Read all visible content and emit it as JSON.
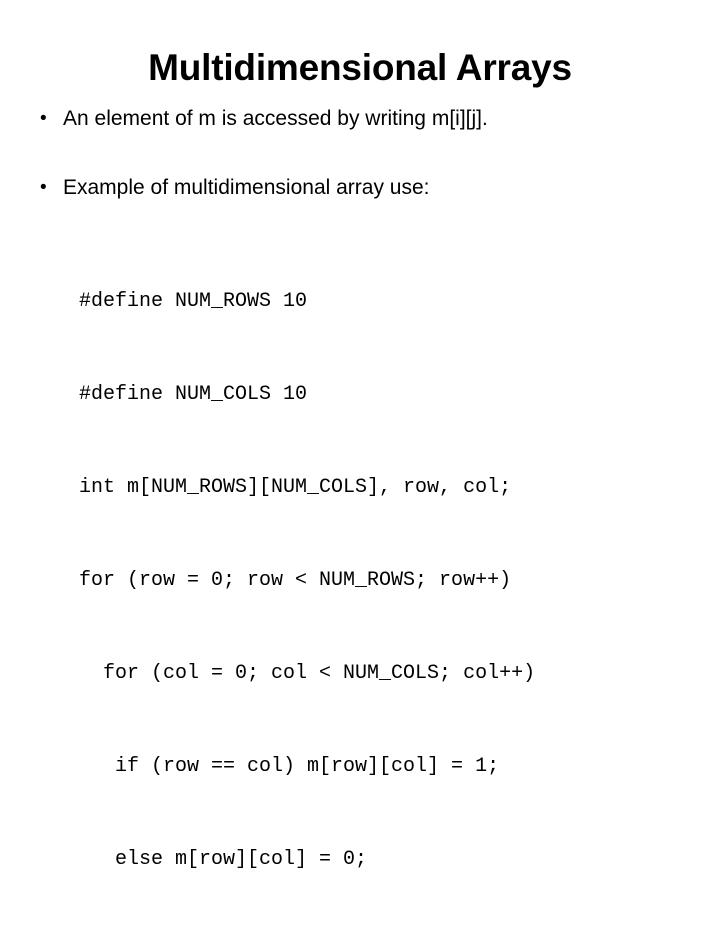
{
  "slide": {
    "title": "Multidimensional Arrays",
    "background_color": "#ffffff",
    "text_color": "#000000",
    "bullet_marker": "•",
    "bullets": [
      {
        "text": "An element of m is accessed by writing m[i][j]."
      },
      {
        "text": "Example of multidimensional array use:"
      }
    ],
    "code": {
      "lines": [
        "#define NUM_ROWS 10",
        "#define NUM_COLS 10",
        "int m[NUM_ROWS][NUM_COLS], row, col;",
        "for (row = 0; row < NUM_ROWS; row++)",
        "  for (col = 0; col < NUM_COLS; col++)",
        "   if (row == col) m[row][col] = 1;",
        "   else m[row][col] = 0;"
      ]
    }
  }
}
